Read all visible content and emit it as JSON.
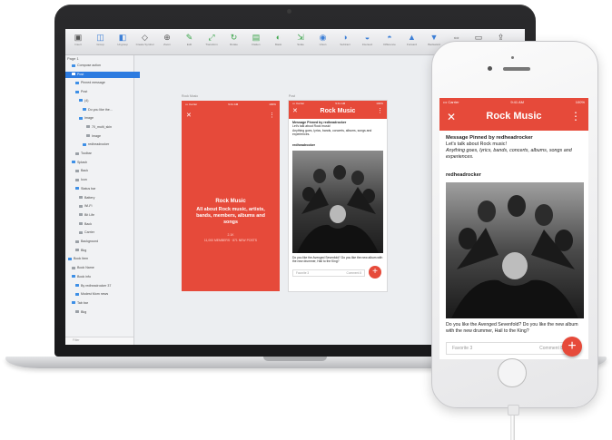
{
  "colors": {
    "accent": "#e64a3a",
    "selection": "#2c7be0"
  },
  "toolbar": {
    "tools": [
      {
        "label": "Insert",
        "icon": "insert-icon"
      },
      {
        "label": "Group",
        "icon": "group-icon"
      },
      {
        "label": "Ungroup",
        "icon": "ungroup-icon"
      },
      {
        "label": "Create Symbol",
        "icon": "symbol-icon"
      },
      {
        "label": "Zoom",
        "icon": "zoom-icon"
      },
      {
        "label": "Edit",
        "icon": "edit-icon"
      },
      {
        "label": "Transform",
        "icon": "transform-icon"
      },
      {
        "label": "Rotate",
        "icon": "rotate-icon"
      },
      {
        "label": "Flatten",
        "icon": "flatten-icon"
      },
      {
        "label": "Mask",
        "icon": "mask-icon"
      },
      {
        "label": "Scale",
        "icon": "scale-icon"
      },
      {
        "label": "Union",
        "icon": "union-icon"
      },
      {
        "label": "Subtract",
        "icon": "subtract-icon"
      },
      {
        "label": "Intersect",
        "icon": "intersect-icon"
      },
      {
        "label": "Difference",
        "icon": "difference-icon"
      },
      {
        "label": "Forward",
        "icon": "forward-icon"
      },
      {
        "label": "Backward",
        "icon": "backward-icon"
      },
      {
        "label": "Mirror",
        "icon": "mirror-icon"
      },
      {
        "label": "View",
        "icon": "view-icon"
      },
      {
        "label": "Export",
        "icon": "export-icon"
      }
    ]
  },
  "sidebar": {
    "page": "Page 1",
    "layers": [
      {
        "label": "Compose action",
        "icon": "folder"
      },
      {
        "label": "Post",
        "icon": "folder",
        "selected": true
      },
      {
        "label": "Pinned message",
        "icon": "folder"
      },
      {
        "label": "Post",
        "icon": "folder"
      },
      {
        "label": "(4)",
        "icon": "folder"
      },
      {
        "label": "Do you like the...",
        "icon": "text"
      },
      {
        "label": "Image",
        "icon": "folder"
      },
      {
        "label": "70_multi_skin",
        "icon": "page"
      },
      {
        "label": "Image",
        "icon": "page"
      },
      {
        "label": "redheadrocker",
        "icon": "text"
      },
      {
        "label": "Toolbar",
        "icon": "page"
      },
      {
        "label": "Splash",
        "icon": "folder"
      },
      {
        "label": "Back",
        "icon": "page"
      },
      {
        "label": "Icon",
        "icon": "page"
      },
      {
        "label": "Status bar",
        "icon": "folder"
      },
      {
        "label": "Battery",
        "icon": "page"
      },
      {
        "label": "Wi-Fi",
        "icon": "page"
      },
      {
        "label": "Bit Life",
        "icon": "page"
      },
      {
        "label": "Back",
        "icon": "page"
      },
      {
        "label": "Carrier",
        "icon": "page"
      },
      {
        "label": "Background",
        "icon": "page"
      },
      {
        "label": "Bkg",
        "icon": "page"
      },
      {
        "label": "Book Item",
        "icon": "folder"
      },
      {
        "label": "Book Name",
        "icon": "page"
      },
      {
        "label": "Book info",
        "icon": "folder"
      },
      {
        "label": "By redheadrocker 37",
        "icon": "text"
      },
      {
        "label": "Modest Mom news",
        "icon": "text"
      },
      {
        "label": "Tab bar",
        "icon": "folder"
      },
      {
        "label": "Bkg",
        "icon": "page"
      }
    ],
    "filter": "Filter"
  },
  "artboard_labels": [
    "Rock Music",
    "Post"
  ],
  "splash": {
    "status_carrier": "••• Carrier",
    "status_time": "9:41 AM",
    "status_battery": "100%",
    "title": "Rock Music",
    "description": "All about Rock music, artists, bands, members, albums and songs",
    "meta": "2.1K",
    "stat": "11,000 MEMBERS · 871 NEW POSTS"
  },
  "post": {
    "status_carrier": "••• Carrier",
    "status_time": "9:41 AM",
    "status_battery": "100%",
    "title": "Rock Music",
    "pinned_heading": "Message Pinned by redheadrocker",
    "pinned_line1": "Let's talk about Rock music!",
    "pinned_line2": "Anything goes, lyrics, bands, concerts, albums, songs and experiences.",
    "author": "redheadrocker",
    "question": "Do you like the Avenged Sevenfold? Do you like the new album with the new drummer, Hail to the King?",
    "action_left": "Favorite 3",
    "action_right": "Comment 8",
    "fab": "+"
  }
}
